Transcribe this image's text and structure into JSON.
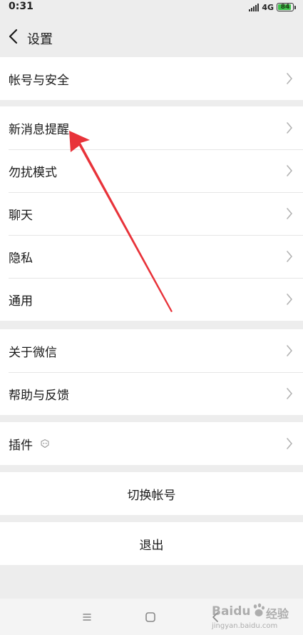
{
  "status_bar": {
    "time": "0:31",
    "network": "4G",
    "battery": "84"
  },
  "header": {
    "title": "设置"
  },
  "groups": {
    "account": {
      "items": [
        {
          "label": "帐号与安全"
        }
      ]
    },
    "main": {
      "items": [
        {
          "label": "新消息提醒"
        },
        {
          "label": "勿扰模式"
        },
        {
          "label": "聊天"
        },
        {
          "label": "隐私"
        },
        {
          "label": "通用"
        }
      ]
    },
    "about": {
      "items": [
        {
          "label": "关于微信"
        },
        {
          "label": "帮助与反馈"
        }
      ]
    },
    "plugins": {
      "items": [
        {
          "label": "插件"
        }
      ]
    }
  },
  "actions": {
    "switch_account": "切换帐号",
    "logout": "退出"
  },
  "watermark": {
    "brand": "Baidu",
    "suffix": "经验",
    "url": "jingyan.baidu.com"
  },
  "colors": {
    "background": "#ededed",
    "cell_background": "#ffffff",
    "arrow": "#e8333a",
    "battery": "#3cc14a"
  }
}
